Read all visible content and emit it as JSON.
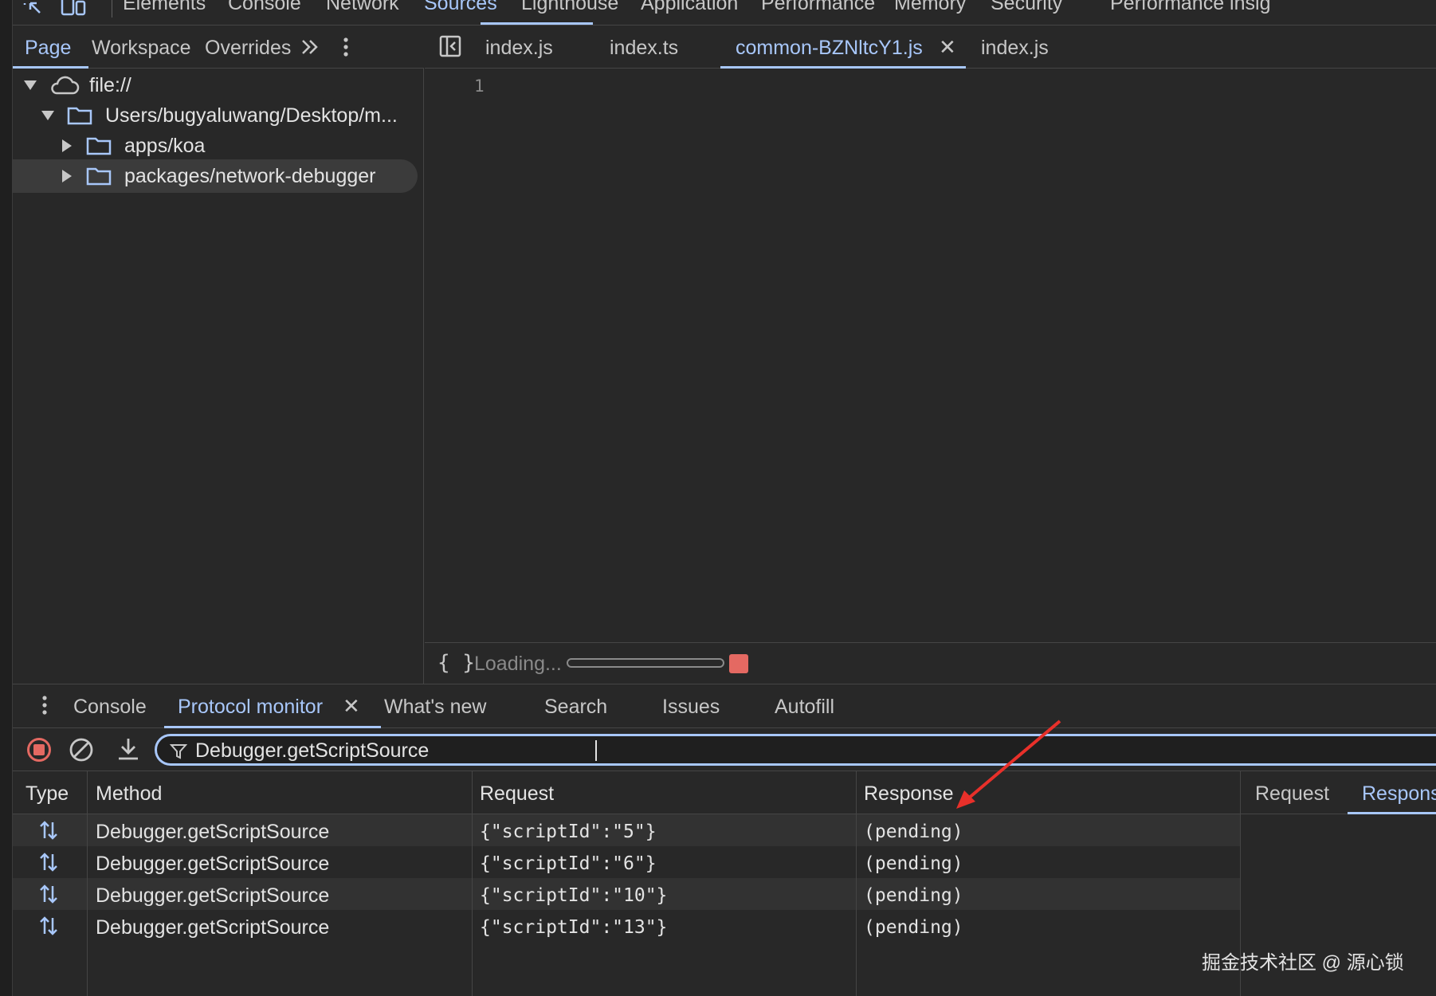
{
  "topbar": {
    "tabs": [
      "Elements",
      "Console",
      "Network",
      "Sources",
      "Lighthouse",
      "Application",
      "Performance",
      "Memory",
      "Security",
      "Performance insig"
    ],
    "active_tab": "Sources"
  },
  "navigator": {
    "tabs": [
      "Page",
      "Workspace",
      "Overrides"
    ],
    "active_tab": "Page",
    "tree": [
      {
        "label": "file://",
        "icon": "cloud-icon",
        "expanded": true
      },
      {
        "label": "Users/bugyaluwang/Desktop/m...",
        "icon": "folder-icon",
        "expanded": true
      },
      {
        "label": "apps/koa",
        "icon": "folder-icon",
        "expanded": false
      },
      {
        "label": "packages/network-debugger",
        "icon": "folder-icon",
        "expanded": false,
        "selected": true
      }
    ]
  },
  "editor": {
    "tabs": [
      "index.js",
      "index.ts",
      "common-BZNltcY1.js",
      "index.js"
    ],
    "active_tab": "common-BZNltcY1.js",
    "line_number": "1",
    "status": {
      "braces": "{ }",
      "loading": "Loading...",
      "progress_percent": 0
    }
  },
  "drawer": {
    "tabs": [
      "Console",
      "Protocol monitor",
      "What's new",
      "Search",
      "Issues",
      "Autofill"
    ],
    "active_tab": "Protocol monitor",
    "filter_value": "Debugger.getScriptSource",
    "columns": [
      "Type",
      "Method",
      "Request",
      "Response"
    ],
    "rows": [
      {
        "method": "Debugger.getScriptSource",
        "request": "{\"scriptId\":\"5\"}",
        "response": "(pending)"
      },
      {
        "method": "Debugger.getScriptSource",
        "request": "{\"scriptId\":\"6\"}",
        "response": "(pending)"
      },
      {
        "method": "Debugger.getScriptSource",
        "request": "{\"scriptId\":\"10\"}",
        "response": "(pending)"
      },
      {
        "method": "Debugger.getScriptSource",
        "request": "{\"scriptId\":\"13\"}",
        "response": "(pending)"
      }
    ],
    "side_tabs": [
      "Request",
      "Respons"
    ],
    "side_active": "Respons"
  },
  "watermark": "掘金技术社区 @ 源心锁",
  "colors": {
    "accent": "#a8c7fa",
    "record_red": "#e46962",
    "annotation_arrow": "#e8302a",
    "background": "#282828"
  }
}
